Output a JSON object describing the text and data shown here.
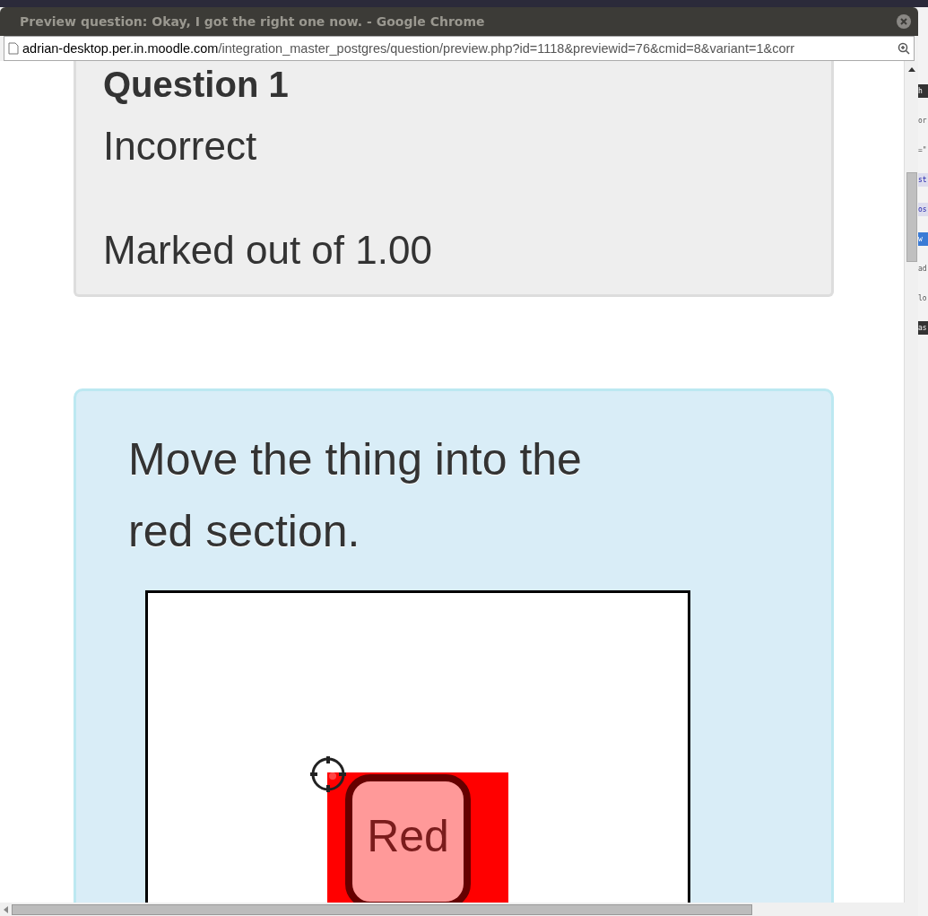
{
  "window": {
    "title": "Preview question: Okay, I got the right one now. - Google Chrome"
  },
  "address_bar": {
    "host": "adrian-desktop.per.in.moodle.com",
    "path": "/integration_master_postgres/question/preview.php?id=1118&previewid=76&cmid=8&variant=1&corr"
  },
  "info_card": {
    "heading": "Question 1",
    "state": "Incorrect",
    "grade": "Marked out of 1.00"
  },
  "question": {
    "text": "Move the thing into the red section.",
    "drop_zone": {
      "label": "Red"
    }
  },
  "background_window": [
    {
      "text": "h",
      "kind": "dark"
    },
    {
      "text": "or",
      "kind": "plain"
    },
    {
      "text": "=\"",
      "kind": "plain"
    },
    {
      "text": "st",
      "kind": "code"
    },
    {
      "text": "os",
      "kind": "code"
    },
    {
      "text": "w",
      "kind": "blue"
    },
    {
      "text": "ad",
      "kind": "plain"
    },
    {
      "text": "lo",
      "kind": "plain"
    },
    {
      "text": "as",
      "kind": "dark"
    }
  ]
}
